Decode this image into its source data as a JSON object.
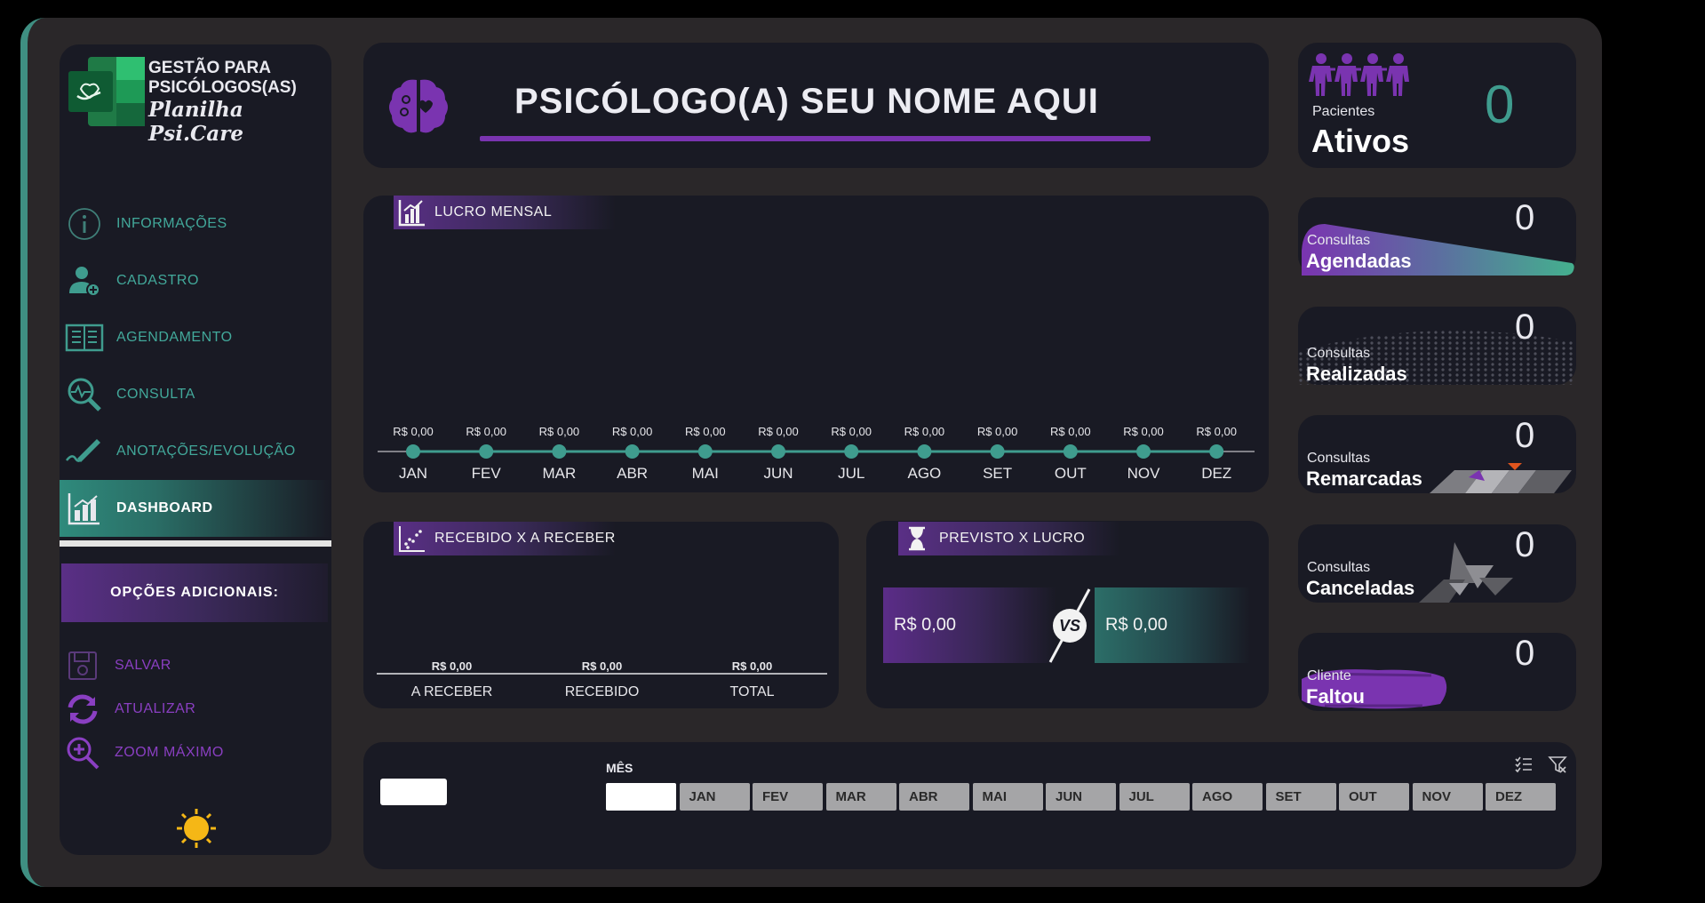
{
  "sidebar": {
    "logo": {
      "line1": "GESTÃO PARA",
      "line2": "PSICÓLOGOS(AS)",
      "script": "Planilha Psi.Care"
    },
    "nav": [
      {
        "label": "INFORMAÇÕES",
        "icon": "info-icon"
      },
      {
        "label": "CADASTRO",
        "icon": "user-add-icon"
      },
      {
        "label": "AGENDAMENTO",
        "icon": "book-icon"
      },
      {
        "label": "CONSULTA",
        "icon": "magnifier-pulse-icon"
      },
      {
        "label": "ANOTAÇÕES/EVOLUÇÃO",
        "icon": "pen-icon"
      },
      {
        "label": "DASHBOARD",
        "icon": "bar-chart-icon",
        "active": true
      }
    ],
    "options_title": "OPÇÕES ADICIONAIS:",
    "options": [
      {
        "label": "SALVAR",
        "icon": "floppy-disk-icon"
      },
      {
        "label": "ATUALIZAR",
        "icon": "refresh-icon"
      },
      {
        "label": "ZOOM MÁXIMO",
        "icon": "zoom-in-icon"
      }
    ]
  },
  "header": {
    "title": "PSICÓLOGO(A) SEU NOME AQUI"
  },
  "kpis": {
    "ativos": {
      "caption": "Pacientes",
      "label": "Ativos",
      "value": "0"
    },
    "agendadas": {
      "caption": "Consultas",
      "label": "Agendadas",
      "value": "0"
    },
    "realizadas": {
      "caption": "Consultas",
      "label": "Realizadas",
      "value": "0"
    },
    "remarcadas": {
      "caption": "Consultas",
      "label": "Remarcadas",
      "value": "0"
    },
    "canceladas": {
      "caption": "Consultas",
      "label": "Canceladas",
      "value": "0"
    },
    "faltou": {
      "caption": "Cliente",
      "label": "Faltou",
      "value": "0"
    }
  },
  "lucro_mensal": {
    "title": "LUCRO MENSAL"
  },
  "recebido": {
    "title": "RECEBIDO X A RECEBER"
  },
  "previsto": {
    "title": "PREVISTO X LUCRO",
    "left_value": "R$ 0,00",
    "vs": "VS",
    "right_value": "R$ 0,00"
  },
  "filter": {
    "label": "MÊS",
    "months": [
      "",
      "JAN",
      "FEV",
      "MAR",
      "ABR",
      "MAI",
      "JUN",
      "JUL",
      "AGO",
      "SET",
      "OUT",
      "NOV",
      "DEZ"
    ]
  },
  "colors": {
    "accent_teal": "#3f9c8e",
    "accent_purple": "#7a34b0",
    "panel": "#191a24",
    "frame": "#2a2729"
  },
  "chart_data": [
    {
      "type": "line",
      "title": "LUCRO MENSAL",
      "categories": [
        "JAN",
        "FEV",
        "MAR",
        "ABR",
        "MAI",
        "JUN",
        "JUL",
        "AGO",
        "SET",
        "OUT",
        "NOV",
        "DEZ"
      ],
      "values": [
        0,
        0,
        0,
        0,
        0,
        0,
        0,
        0,
        0,
        0,
        0,
        0
      ],
      "data_labels": [
        "R$ 0,00",
        "R$ 0,00",
        "R$ 0,00",
        "R$ 0,00",
        "R$ 0,00",
        "R$ 0,00",
        "R$ 0,00",
        "R$ 0,00",
        "R$ 0,00",
        "R$ 0,00",
        "R$ 0,00",
        "R$ 0,00"
      ]
    },
    {
      "type": "bar",
      "title": "RECEBIDO X A RECEBER",
      "categories": [
        "A RECEBER",
        "RECEBIDO",
        "TOTAL"
      ],
      "values": [
        0,
        0,
        0
      ],
      "data_labels": [
        "R$ 0,00",
        "R$ 0,00",
        "R$ 0,00"
      ]
    }
  ]
}
